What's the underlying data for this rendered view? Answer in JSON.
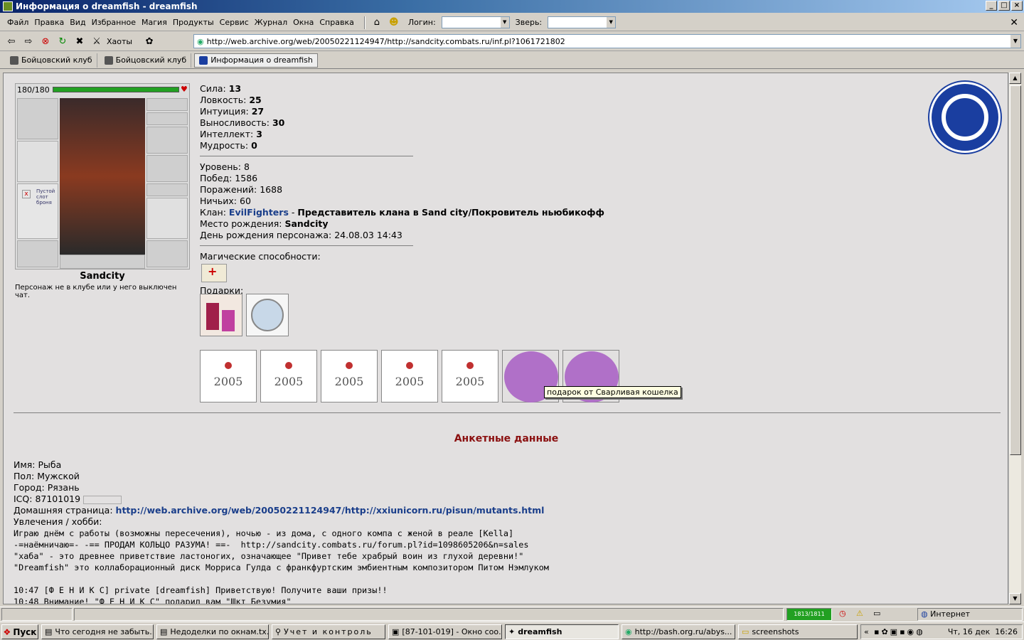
{
  "window": {
    "title": "Информация о dreamfish - dreamfish"
  },
  "menu": {
    "items": [
      "Файл",
      "Правка",
      "Вид",
      "Избранное",
      "Магия",
      "Продукты",
      "Сервис",
      "Журнал",
      "Окна",
      "Справка"
    ],
    "login_label": "Логин:",
    "beast_label": "Зверь:"
  },
  "nav": {
    "chaos_label": "Хаоты",
    "address": "http://web.archive.org/web/20050221124947/http://sandcity.combats.ru/inf.pl?1061721802"
  },
  "tabs": [
    "Бойцовский клуб",
    "Бойцовский клуб",
    "Информация о dreamfish"
  ],
  "character": {
    "hp": "180/180",
    "empty_slot_text": "Пустой слот броня",
    "city": "Sandcity",
    "status_note": "Персонаж не в клубе или у него выключен чат."
  },
  "stats": {
    "strength_label": "Сила:",
    "strength": "13",
    "agility_label": "Ловкость:",
    "agility": "25",
    "intuition_label": "Интуиция:",
    "intuition": "27",
    "endurance_label": "Выносливость:",
    "endurance": "30",
    "intellect_label": "Интеллект:",
    "intellect": "3",
    "wisdom_label": "Мудрость:",
    "wisdom": "0",
    "level_label": "Уровень:",
    "level": "8",
    "wins_label": "Побед:",
    "wins": "1586",
    "losses_label": "Поражений:",
    "losses": "1688",
    "draws_label": "Ничьих:",
    "draws": "60",
    "clan_label": "Клан:",
    "clan_name": "EvilFighters",
    "clan_sep": " - ",
    "clan_title": "Представитель клана в Sand city/Покровитель ньюбикофф",
    "birthplace_label": "Место рождения:",
    "birthplace": "Sandcity",
    "birthday_label": "День рождения персонажа:",
    "birthday": "24.08.03 14:43",
    "magic_label": "Магические способности:",
    "gifts_label": "Подарки:"
  },
  "gifts": {
    "year_text": "2005",
    "tooltip": "подарок от Сварливая кошелка"
  },
  "profile": {
    "title": "Анкетные данные",
    "name_label": "Имя:",
    "name": "Рыба",
    "gender_label": "Пол:",
    "gender": "Мужской",
    "city_label": "Город:",
    "city": "Рязань",
    "icq_label": "ICQ:",
    "icq": "87101019",
    "homepage_label": "Домашняя страница:",
    "homepage": "http://web.archive.org/web/20050221124947/http://xxiunicorn.ru/pisun/mutants.html",
    "hobby_label": "Увлечения / хобби:",
    "hobby_lines": [
      "Играю днём с работы (возможны пересечения), ночью - из дома, с одного компа с женой в реале [Kella]",
      "-=наёмничаю=- -== ПРОДАМ КОЛЬЦО РАЗУМА! ==-  http://sandcity.combats.ru/forum.pl?id=1098605206&n=sales",
      "\"хаба\" - это древнее приветствие ластоногих, означающее \"Привет тебе храбрый воин из глухой деревни!\"",
      "\"Dreamfish\" это коллаборационный диск Морриса Гулда с франкфуртским эмбиентным композитором Питом Нэмлуком",
      "",
      "10:47 [Ф Е Н И К С] private [dreamfish] Приветствую! Получите ваши призы!!",
      "10:48 Внимание! \"Ф Е Н И К С\" подарил вам \"Шкт Безумия\""
    ]
  },
  "statusbar": {
    "zone": "Интернет",
    "progress_text": "1813/1811"
  },
  "taskbar": {
    "start": "Пуск",
    "buttons": [
      "Что сегодня не забыть...",
      "Недоделки по окнам.tx...",
      "Учет и контроль",
      "[87-101-019] - Окно соо...",
      "dreamfish",
      "http://bash.org.ru/abys...",
      "screenshots"
    ],
    "clock": "Чт, 16 дек  16:26"
  }
}
